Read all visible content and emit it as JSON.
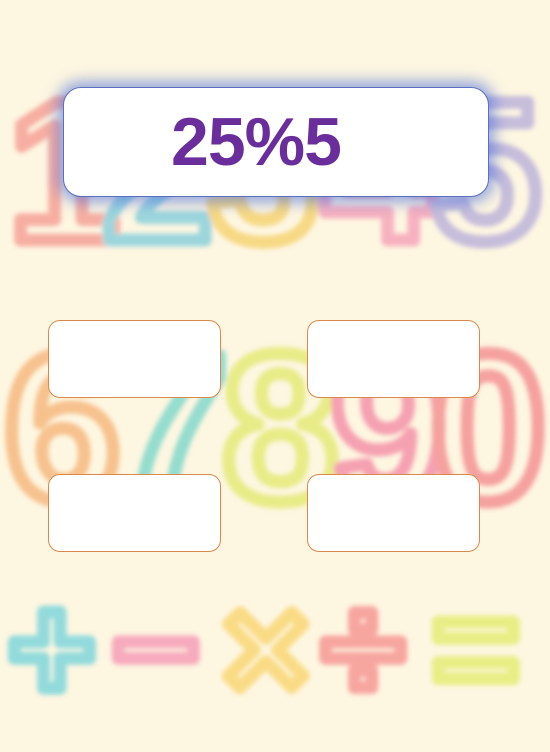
{
  "game": {
    "question": "25%5",
    "answers": [
      "",
      "",
      "",
      ""
    ]
  },
  "background": {
    "decoration": "crayon-drawn digits 1-9, 0 and math operators + - × ÷ =",
    "glyphs": [
      "1",
      "2",
      "3",
      "4",
      "5",
      "6",
      "7",
      "8",
      "9",
      "0",
      "+",
      "−",
      "×",
      "÷",
      "="
    ],
    "colors": {
      "paper": "#fdf6e1",
      "question_text": "#6a2d9c",
      "panel_glow": "#4669dc",
      "answer_border": "#d98a4a"
    }
  }
}
